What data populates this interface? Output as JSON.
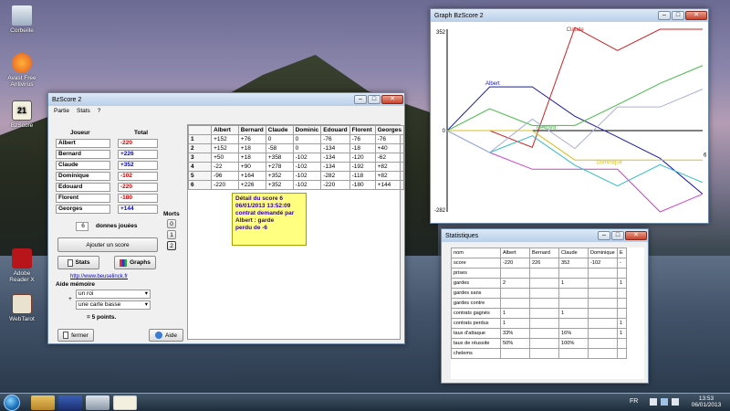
{
  "desktop": {
    "icons": [
      {
        "label": "Corbeille",
        "icon": "recycle-bin-icon"
      },
      {
        "label": "Avast Free Antivirus",
        "icon": "avast-icon"
      },
      {
        "label": "BzScore",
        "icon": "bzscore-icon"
      },
      {
        "label": "Adobe Reader X",
        "icon": "adobe-reader-icon"
      },
      {
        "label": "WebTarot",
        "icon": "webtarot-icon"
      }
    ]
  },
  "bzscore": {
    "title": "BzScore 2",
    "menu": [
      "Partie",
      "Stats",
      "?"
    ],
    "col_player": "Joueur",
    "col_total": "Total",
    "players": [
      {
        "name": "Albert",
        "total": "-220",
        "color": "#cc0000"
      },
      {
        "name": "Bernard",
        "total": "+226",
        "color": "#0000cc"
      },
      {
        "name": "Claude",
        "total": "+352",
        "color": "#0000cc"
      },
      {
        "name": "Dominique",
        "total": "-102",
        "color": "#cc0000"
      },
      {
        "name": "Edouard",
        "total": "-220",
        "color": "#cc0000"
      },
      {
        "name": "Florent",
        "total": "-180",
        "color": "#cc0000"
      },
      {
        "name": "Georges",
        "total": "+144",
        "color": "#0000cc"
      }
    ],
    "games_count": "6",
    "games_label": "donnes jouées",
    "morts_label": "Morts",
    "morts_values": [
      "0",
      "1",
      "2"
    ],
    "add_score_label": "Ajouter un score",
    "stats_label": "Stats",
    "graphs_label": "Graphs",
    "website": "http://www.beuselinck.fr",
    "aide_memoire_title": "Aide mémoire",
    "memo_select1": "un roi",
    "memo_select2": "une carte basse",
    "memo_result": "= 5 points.",
    "close_label": "fermer",
    "help_label": "Aide",
    "table_headers": [
      "",
      "Albert",
      "Bernard",
      "Claude",
      "Dominic",
      "Edouard",
      "Florent",
      "Georges"
    ],
    "table_rows": [
      [
        "1",
        "+152",
        "+76",
        "0",
        "0",
        "-76",
        "-76",
        "-76"
      ],
      [
        "2",
        "+152",
        "+18",
        "-58",
        "0",
        "-134",
        "-18",
        "+40"
      ],
      [
        "3",
        "+50",
        "+18",
        "+358",
        "-102",
        "-134",
        "-120",
        "-62"
      ],
      [
        "4",
        "-22",
        "+90",
        "+278",
        "-102",
        "-134",
        "-192",
        "+82"
      ],
      [
        "5",
        "-96",
        "+164",
        "+352",
        "-102",
        "-282",
        "-118",
        "+82"
      ],
      [
        "6",
        "-220",
        "+226",
        "+352",
        "-102",
        "-220",
        "-180",
        "+144"
      ]
    ],
    "tooltip": [
      "Détail du score 6",
      "06/01/2013 13:52:09",
      "contrat demandé par",
      "Albert : garde",
      "perdu de -6"
    ]
  },
  "graph": {
    "title": "Graph BzScore 2",
    "ytop": "352",
    "yzero": "0",
    "ybottom": "-282",
    "xlabel_right": "6",
    "labels": {
      "claude": "Claude",
      "albert": "Albert",
      "bernard": "Bernard",
      "dominique": "Dominique"
    },
    "colors": {
      "Albert": "#1a1ab0",
      "Bernard": "#44bb44",
      "Claude": "#cc2222",
      "Dominique": "#d8c020",
      "Edouard": "#cc44cc",
      "Florent": "#33bbcc",
      "Georges": "#aab0d8"
    },
    "chart_data": {
      "type": "line",
      "x": [
        0,
        1,
        2,
        3,
        4,
        5,
        6
      ],
      "series": [
        {
          "name": "Albert",
          "values": [
            0,
            152,
            152,
            50,
            -22,
            -96,
            -220
          ]
        },
        {
          "name": "Bernard",
          "values": [
            0,
            76,
            18,
            18,
            90,
            164,
            226
          ]
        },
        {
          "name": "Claude",
          "values": [
            0,
            0,
            -58,
            358,
            278,
            352,
            352
          ]
        },
        {
          "name": "Dominique",
          "values": [
            0,
            0,
            0,
            -102,
            -102,
            -102,
            -102
          ]
        },
        {
          "name": "Edouard",
          "values": [
            0,
            -76,
            -134,
            -134,
            -134,
            -282,
            -220
          ]
        },
        {
          "name": "Florent",
          "values": [
            0,
            -76,
            -18,
            -120,
            -192,
            -118,
            -180
          ]
        },
        {
          "name": "Georges",
          "values": [
            0,
            -76,
            40,
            -62,
            82,
            82,
            144
          ]
        }
      ],
      "ylim": [
        -282,
        352
      ]
    }
  },
  "stats": {
    "title": "Statistiques",
    "headers": [
      "nom",
      "Albert",
      "Bernard",
      "Claude",
      "Dominique",
      "E"
    ],
    "rows": [
      [
        "score",
        "-220",
        "226",
        "352",
        "-102",
        "-"
      ],
      [
        "prises",
        "",
        "",
        "",
        "",
        ""
      ],
      [
        "gardes",
        "2",
        "",
        "1",
        "",
        "1"
      ],
      [
        "gardes sans",
        "",
        "",
        "",
        "",
        ""
      ],
      [
        "gardes contre",
        "",
        "",
        "",
        "",
        ""
      ],
      [
        "contrats gagnés",
        "1",
        "",
        "1",
        "",
        ""
      ],
      [
        "contrats perdus",
        "1",
        "",
        "",
        "",
        "1"
      ],
      [
        "taux d'attaque",
        "33%",
        "",
        "16%",
        "",
        "1"
      ],
      [
        "taux de réussite",
        "50%",
        "",
        "100%",
        "",
        ""
      ],
      [
        "chelems",
        "",
        "",
        "",
        "",
        ""
      ]
    ]
  },
  "taskbar": {
    "lang": "FR",
    "time": "13:53",
    "date": "06/01/2013"
  }
}
